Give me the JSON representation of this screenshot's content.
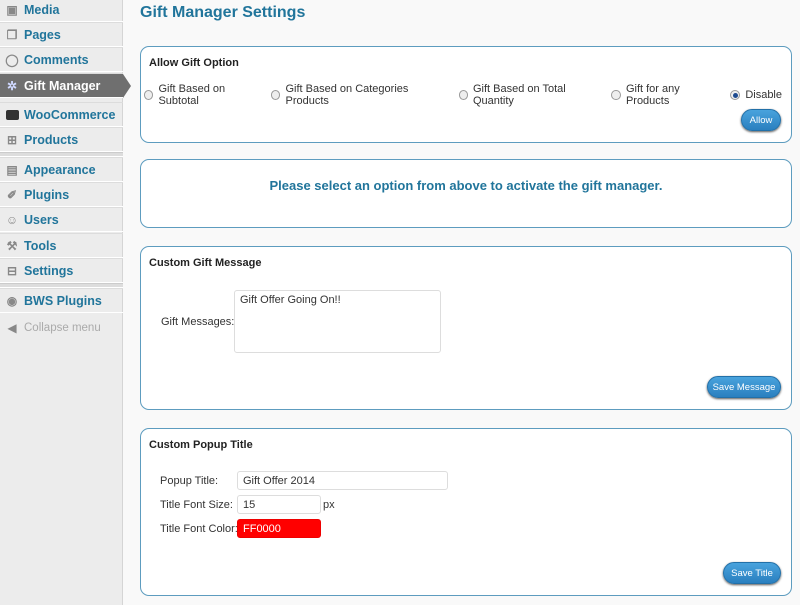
{
  "sidebar": {
    "items": [
      {
        "label": "Media",
        "icon": "media-icon"
      },
      {
        "label": "Pages",
        "icon": "pages-icon"
      },
      {
        "label": "Comments",
        "icon": "comments-icon"
      },
      {
        "label": "Gift Manager",
        "icon": "gear-icon",
        "active": true
      },
      {
        "label": "WooCommerce",
        "icon": "woocommerce-icon"
      },
      {
        "label": "Products",
        "icon": "cart-icon"
      },
      {
        "label": "Appearance",
        "icon": "appearance-icon"
      },
      {
        "label": "Plugins",
        "icon": "plug-icon"
      },
      {
        "label": "Users",
        "icon": "users-icon"
      },
      {
        "label": "Tools",
        "icon": "tools-icon"
      },
      {
        "label": "Settings",
        "icon": "settings-icon"
      },
      {
        "label": "BWS Plugins",
        "icon": "bws-icon"
      }
    ],
    "collapse": "Collapse menu"
  },
  "page_title": "Gift Manager Settings",
  "allow": {
    "title": "Allow Gift Option",
    "options": [
      "Gift Based on Subtotal",
      "Gift Based on Categories Products",
      "Gift Based on Total Quantity",
      "Gift for any Products",
      "Disable"
    ],
    "selected": "Disable",
    "button": "Allow"
  },
  "notice": "Please select an option from above to activate the gift manager.",
  "message": {
    "title": "Custom Gift Message",
    "label": "Gift Messages:",
    "value": "Gift Offer Going On!!",
    "button": "Save Message"
  },
  "popup": {
    "title": "Custom Popup Title",
    "title_label": "Popup Title:",
    "title_value": "Gift Offer 2014",
    "size_label": "Title Font Size:",
    "size_value": "15",
    "size_unit": "px",
    "color_label": "Title Font Color:",
    "color_value": "FF0000",
    "color_swatch": "#ff0000",
    "button": "Save Title"
  }
}
